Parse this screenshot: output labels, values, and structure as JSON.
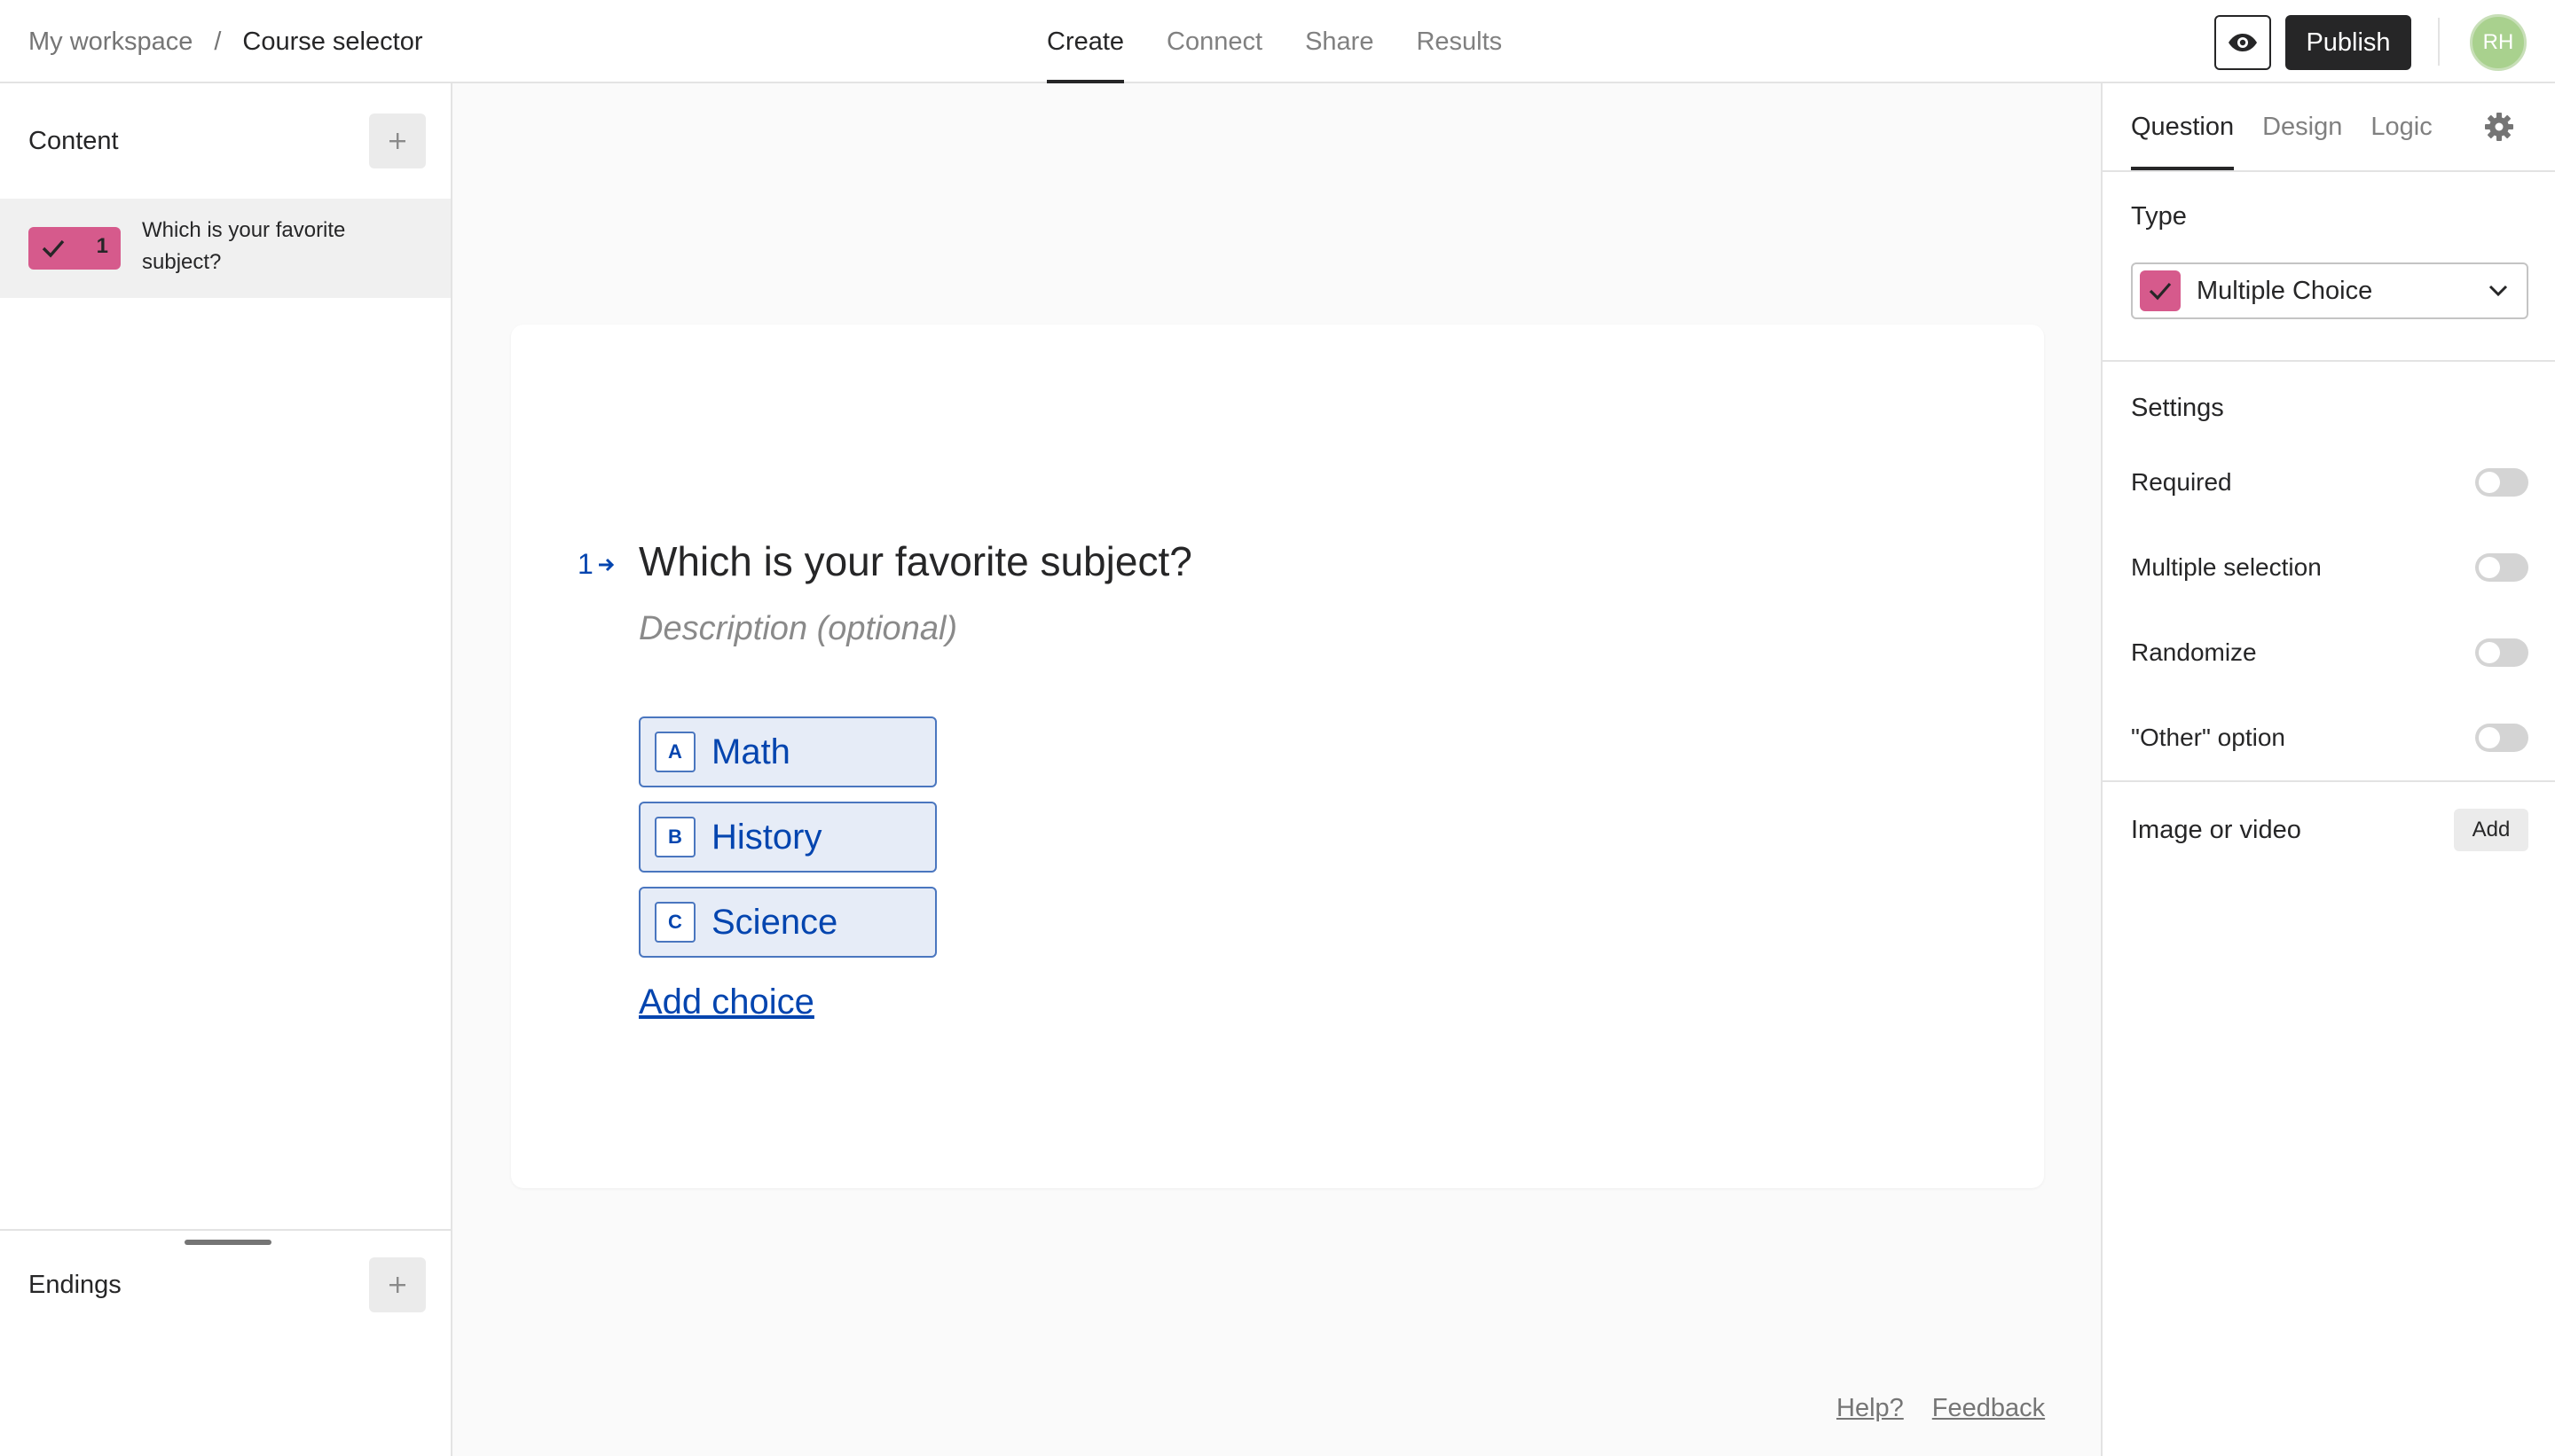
{
  "header": {
    "breadcrumb": {
      "workspace": "My workspace",
      "separator": "/",
      "page": "Course selector"
    },
    "tabs": [
      {
        "label": "Create",
        "active": true
      },
      {
        "label": "Connect",
        "active": false
      },
      {
        "label": "Share",
        "active": false
      },
      {
        "label": "Results",
        "active": false
      }
    ],
    "preview_icon": "eye-icon",
    "publish_label": "Publish",
    "avatar_initials": "RH"
  },
  "sidebar": {
    "content_label": "Content",
    "items": [
      {
        "number": "1",
        "text": "Which is your favorite subject?",
        "badge_color": "#d65a8c"
      }
    ],
    "endings_label": "Endings"
  },
  "question": {
    "number": "1",
    "title": "Which is your favorite subject?",
    "description_placeholder": "Description (optional)",
    "choices": [
      {
        "key": "A",
        "label": "Math"
      },
      {
        "key": "B",
        "label": "History"
      },
      {
        "key": "C",
        "label": "Science"
      }
    ],
    "add_choice_label": "Add choice",
    "accent_color": "#0445af"
  },
  "footer": {
    "help": "Help?",
    "feedback": "Feedback"
  },
  "rightpanel": {
    "tabs": [
      {
        "label": "Question",
        "active": true
      },
      {
        "label": "Design",
        "active": false
      },
      {
        "label": "Logic",
        "active": false
      }
    ],
    "type_label": "Type",
    "type_value": "Multiple Choice",
    "settings_label": "Settings",
    "settings": [
      {
        "label": "Required",
        "on": false
      },
      {
        "label": "Multiple selection",
        "on": false
      },
      {
        "label": "Randomize",
        "on": false
      },
      {
        "label": "\"Other\" option",
        "on": false
      }
    ],
    "media_label": "Image or video",
    "media_add": "Add"
  }
}
